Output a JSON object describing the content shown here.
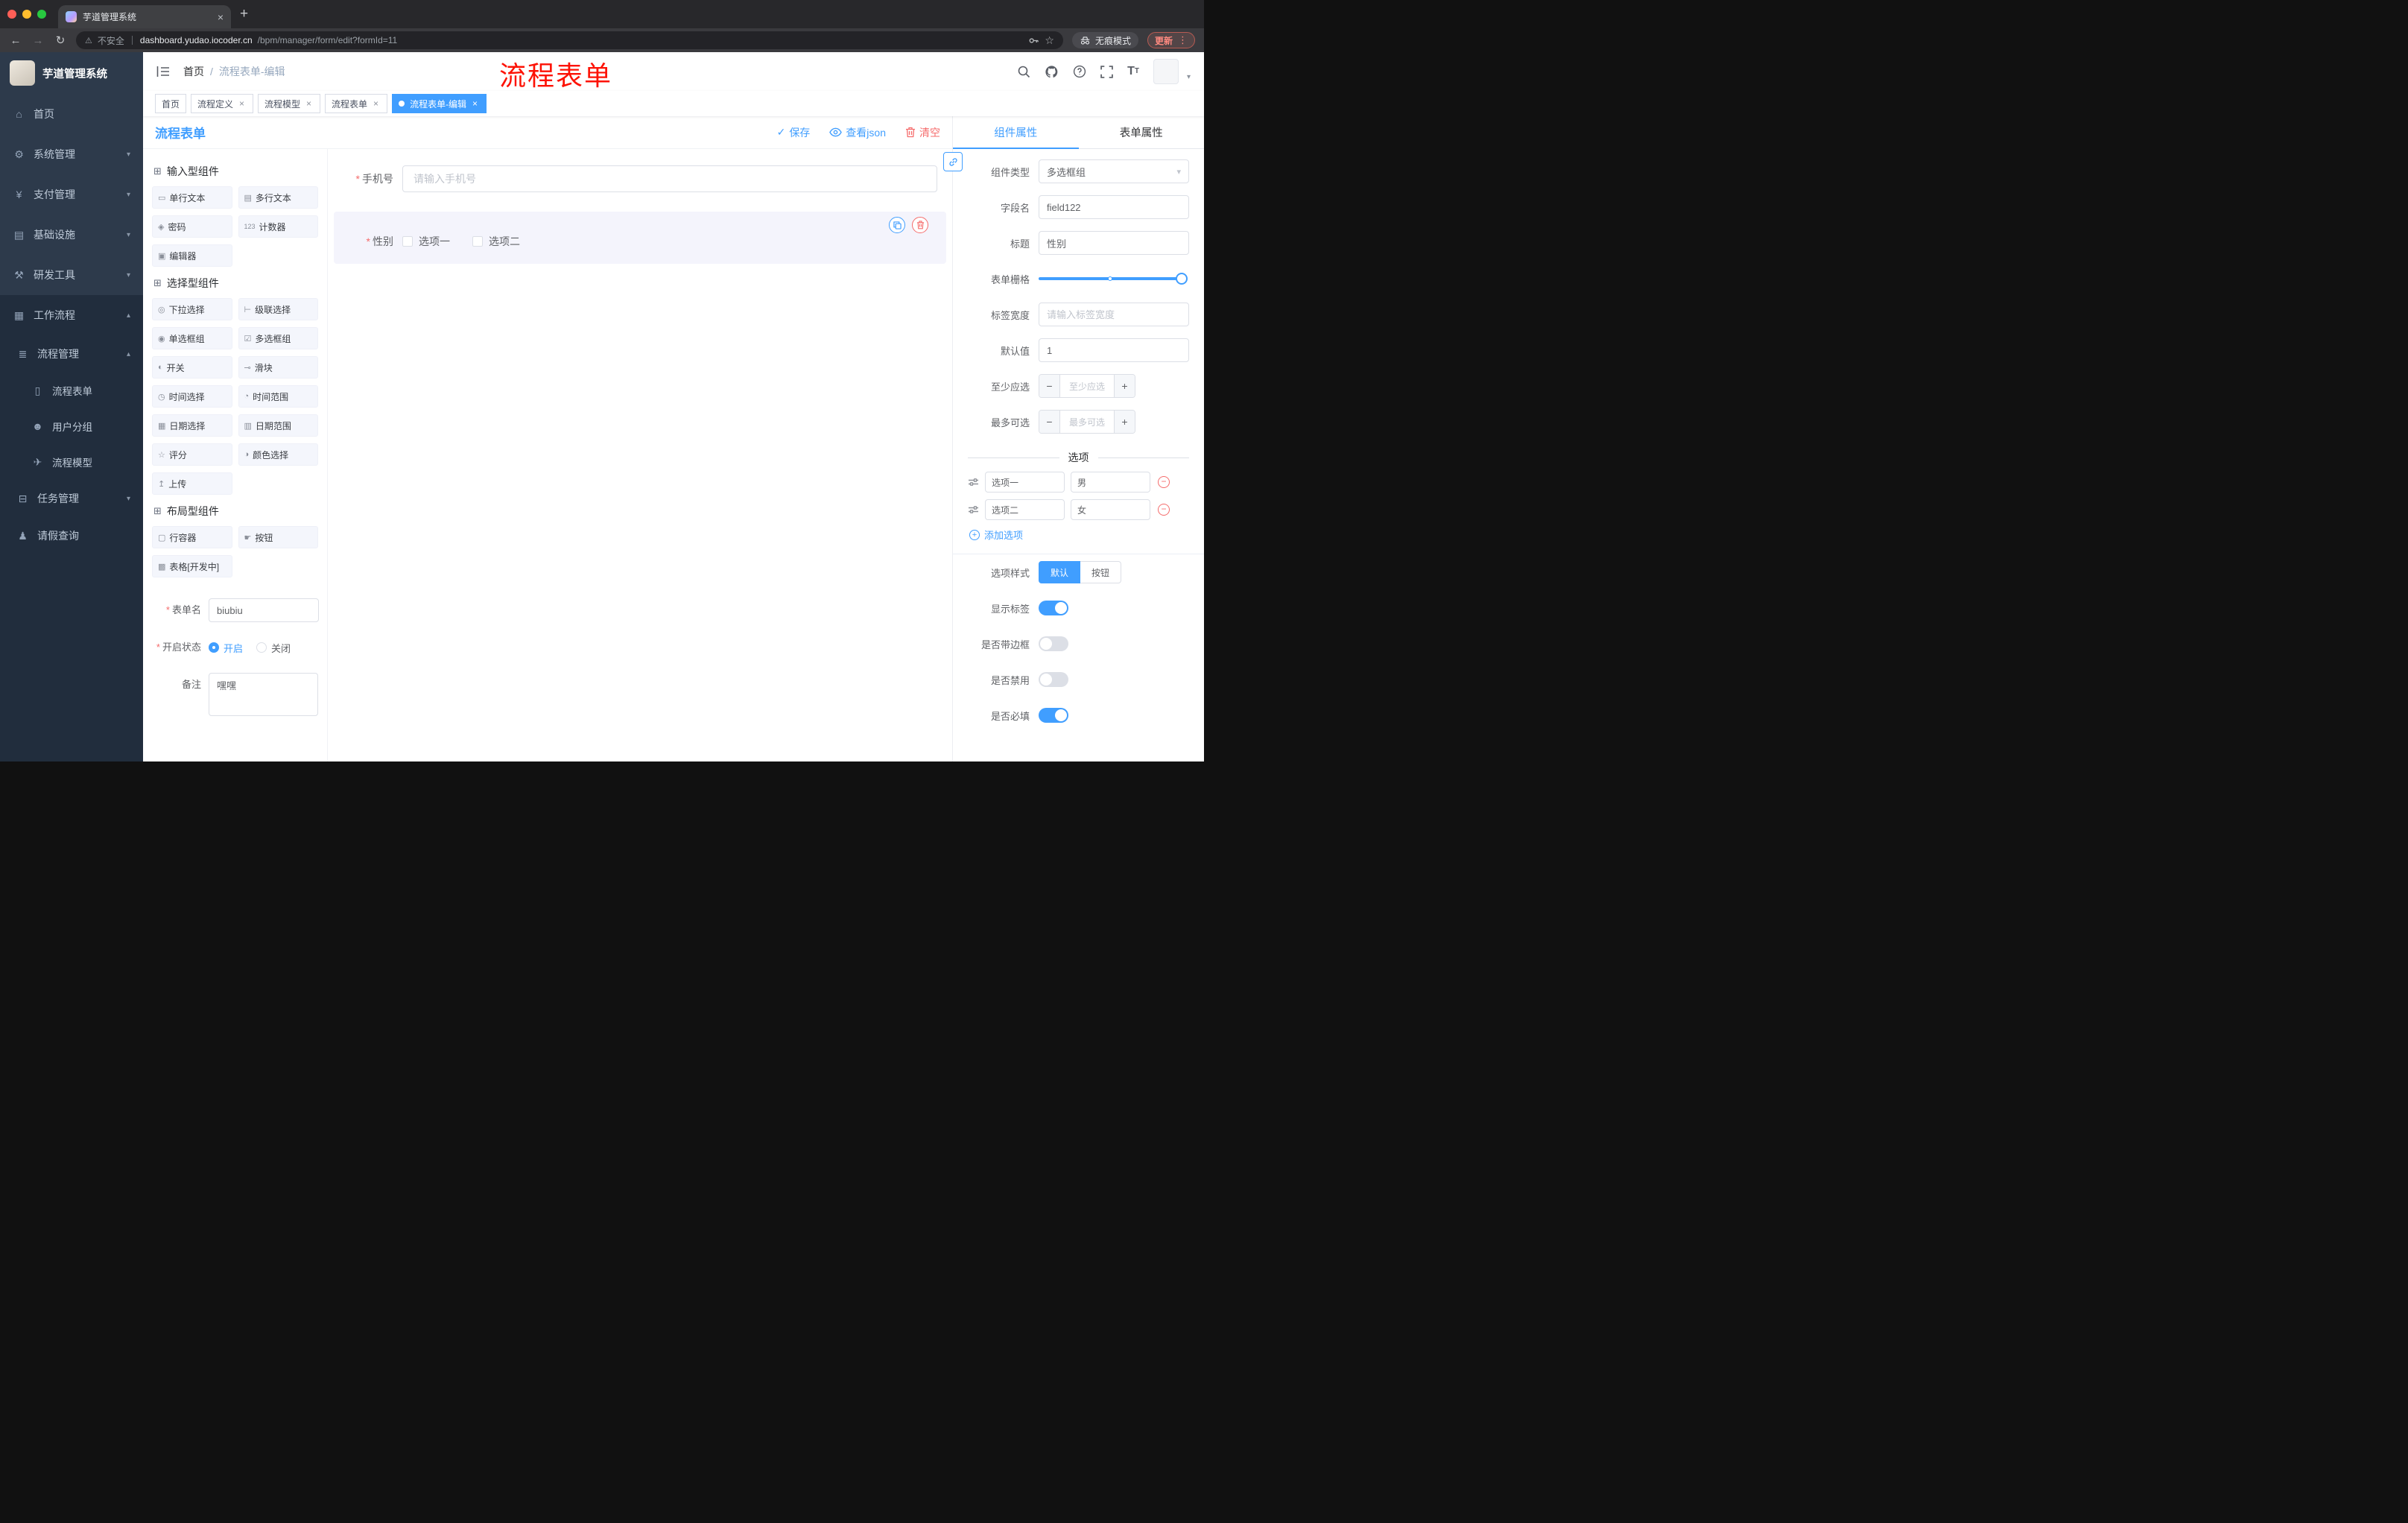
{
  "ui": {
    "close": "×",
    "plus": "+",
    "minus": "−",
    "check": "✓",
    "caret_down": "▾",
    "caret_up": "▴",
    "slash": "/",
    "ellipsis_v": "⋮",
    "warning": "⚠",
    "arrow_left": "←",
    "arrow_right": "→",
    "reload": "↻",
    "star": "☆"
  },
  "colors": {
    "accent": "#409eff",
    "danger": "#f56c6c",
    "annotation_red": "#fd1205",
    "sidebar_bg": "#2d3a4b",
    "submenu_bg": "#212d3d"
  },
  "browser": {
    "tab_title": "芋道管理系统",
    "security_label": "不安全",
    "url_host": "dashboard.yudao.iocoder.cn",
    "url_path": "/bpm/manager/form/edit?formId=11",
    "incognito_label": "无痕模式",
    "update_label": "更新"
  },
  "sidebar": {
    "logo_title": "芋道管理系统",
    "items": [
      {
        "label": "首页",
        "icon": "home-icon",
        "glyph": "⌂"
      },
      {
        "label": "系统管理",
        "icon": "system-icon",
        "glyph": "⚙"
      },
      {
        "label": "支付管理",
        "icon": "payment-icon",
        "glyph": "¥"
      },
      {
        "label": "基础设施",
        "icon": "infrastructure-icon",
        "glyph": "▤"
      },
      {
        "label": "研发工具",
        "icon": "devtools-icon",
        "glyph": "⚒"
      },
      {
        "label": "工作流程",
        "icon": "workflow-icon",
        "glyph": "▦"
      }
    ],
    "workflow_submenu": {
      "process_mgmt": {
        "label": "流程管理",
        "icon": "process-management-icon",
        "glyph": "≣"
      },
      "process_children": [
        {
          "label": "流程表单",
          "icon": "process-form-icon",
          "glyph": "▯"
        },
        {
          "label": "用户分组",
          "icon": "user-group-icon",
          "glyph": "☻"
        },
        {
          "label": "流程模型",
          "icon": "process-model-icon",
          "glyph": "✈"
        }
      ],
      "task_mgmt": {
        "label": "任务管理",
        "icon": "task-management-icon",
        "glyph": "⊟"
      },
      "leave_query": {
        "label": "请假查询",
        "icon": "leave-query-icon",
        "glyph": "♟"
      }
    }
  },
  "header": {
    "breadcrumb": {
      "home": "首页",
      "current": "流程表单-编辑"
    },
    "annotation": "流程表单"
  },
  "tags": [
    {
      "label": "首页",
      "closable": false,
      "active": false
    },
    {
      "label": "流程定义",
      "closable": true,
      "active": false
    },
    {
      "label": "流程模型",
      "closable": true,
      "active": false
    },
    {
      "label": "流程表单",
      "closable": true,
      "active": false
    },
    {
      "label": "流程表单-编辑",
      "closable": true,
      "active": true
    }
  ],
  "designer": {
    "title": "流程表单",
    "actions": {
      "save": "保存",
      "view_json": "查看json",
      "clear": "清空"
    },
    "palette": {
      "groups": [
        {
          "title": "输入型组件",
          "icon": "component-group-icon",
          "glyph": "⊞",
          "items": [
            {
              "label": "单行文本",
              "icon": "single-line-text-icon",
              "glyph": "▭"
            },
            {
              "label": "多行文本",
              "icon": "multiline-text-icon",
              "glyph": "▤"
            },
            {
              "label": "密码",
              "icon": "password-icon",
              "glyph": "◈"
            },
            {
              "label": "计数器",
              "icon": "counter-icon",
              "glyph": "123"
            },
            {
              "label": "编辑器",
              "icon": "editor-icon",
              "glyph": "▣"
            }
          ]
        },
        {
          "title": "选择型组件",
          "icon": "component-group-icon",
          "glyph": "⊞",
          "items": [
            {
              "label": "下拉选择",
              "icon": "select-icon",
              "glyph": "◎"
            },
            {
              "label": "级联选择",
              "icon": "cascader-icon",
              "glyph": "⊢"
            },
            {
              "label": "单选框组",
              "icon": "radio-group-icon",
              "glyph": "◉"
            },
            {
              "label": "多选框组",
              "icon": "checkbox-group-icon",
              "glyph": "☑"
            },
            {
              "label": "开关",
              "icon": "switch-icon",
              "glyph": "◐"
            },
            {
              "label": "滑块",
              "icon": "slider-icon",
              "glyph": "⊸"
            },
            {
              "label": "时间选择",
              "icon": "time-picker-icon",
              "glyph": "◷"
            },
            {
              "label": "时间范围",
              "icon": "time-range-icon",
              "glyph": "◔"
            },
            {
              "label": "日期选择",
              "icon": "date-picker-icon",
              "glyph": "▦"
            },
            {
              "label": "日期范围",
              "icon": "date-range-icon",
              "glyph": "▥"
            },
            {
              "label": "评分",
              "icon": "rate-icon",
              "glyph": "☆"
            },
            {
              "label": "颜色选择",
              "icon": "color-picker-icon",
              "glyph": "◑"
            },
            {
              "label": "上传",
              "icon": "upload-icon",
              "glyph": "↥"
            }
          ]
        },
        {
          "title": "布局型组件",
          "icon": "component-group-icon",
          "glyph": "⊞",
          "items": [
            {
              "label": "行容器",
              "icon": "row-container-icon",
              "glyph": "▢"
            },
            {
              "label": "按钮",
              "icon": "button-icon",
              "glyph": "☛"
            },
            {
              "label": "表格[开发中]",
              "icon": "table-icon",
              "glyph": "▩"
            }
          ]
        }
      ]
    },
    "meta": {
      "form_name": {
        "label": "表单名",
        "value": "biubiu"
      },
      "status": {
        "label": "开启状态",
        "on": "开启",
        "off": "关闭"
      },
      "remark": {
        "label": "备注",
        "value": "嘿嘿"
      }
    },
    "canvas": {
      "phone": {
        "label": "手机号",
        "placeholder": "请输入手机号"
      },
      "gender": {
        "label": "性别",
        "option1": "选项一",
        "option2": "选项二"
      }
    }
  },
  "props": {
    "tabs": {
      "component": "组件属性",
      "form": "表单属性"
    },
    "component_type": {
      "label": "组件类型",
      "value": "多选框组"
    },
    "field_name": {
      "label": "字段名",
      "value": "field122"
    },
    "title": {
      "label": "标题",
      "value": "性别"
    },
    "grid": {
      "label": "表单栅格"
    },
    "label_width": {
      "label": "标签宽度",
      "placeholder": "请输入标签宽度"
    },
    "default_value": {
      "label": "默认值",
      "value": "1"
    },
    "min_select": {
      "label": "至少应选",
      "placeholder": "至少应选"
    },
    "max_select": {
      "label": "最多可选",
      "placeholder": "最多可选"
    },
    "options": {
      "title": "选项",
      "rows": [
        {
          "name": "选项一",
          "value": "男"
        },
        {
          "name": "选项二",
          "value": "女"
        }
      ],
      "add_label": "添加选项"
    },
    "option_style": {
      "label": "选项样式",
      "default_btn": "默认",
      "button_btn": "按钮"
    },
    "switches": [
      {
        "label": "显示标签",
        "on": true
      },
      {
        "label": "是否带边框",
        "on": false
      },
      {
        "label": "是否禁用",
        "on": false
      },
      {
        "label": "是否必填",
        "on": true
      }
    ]
  }
}
